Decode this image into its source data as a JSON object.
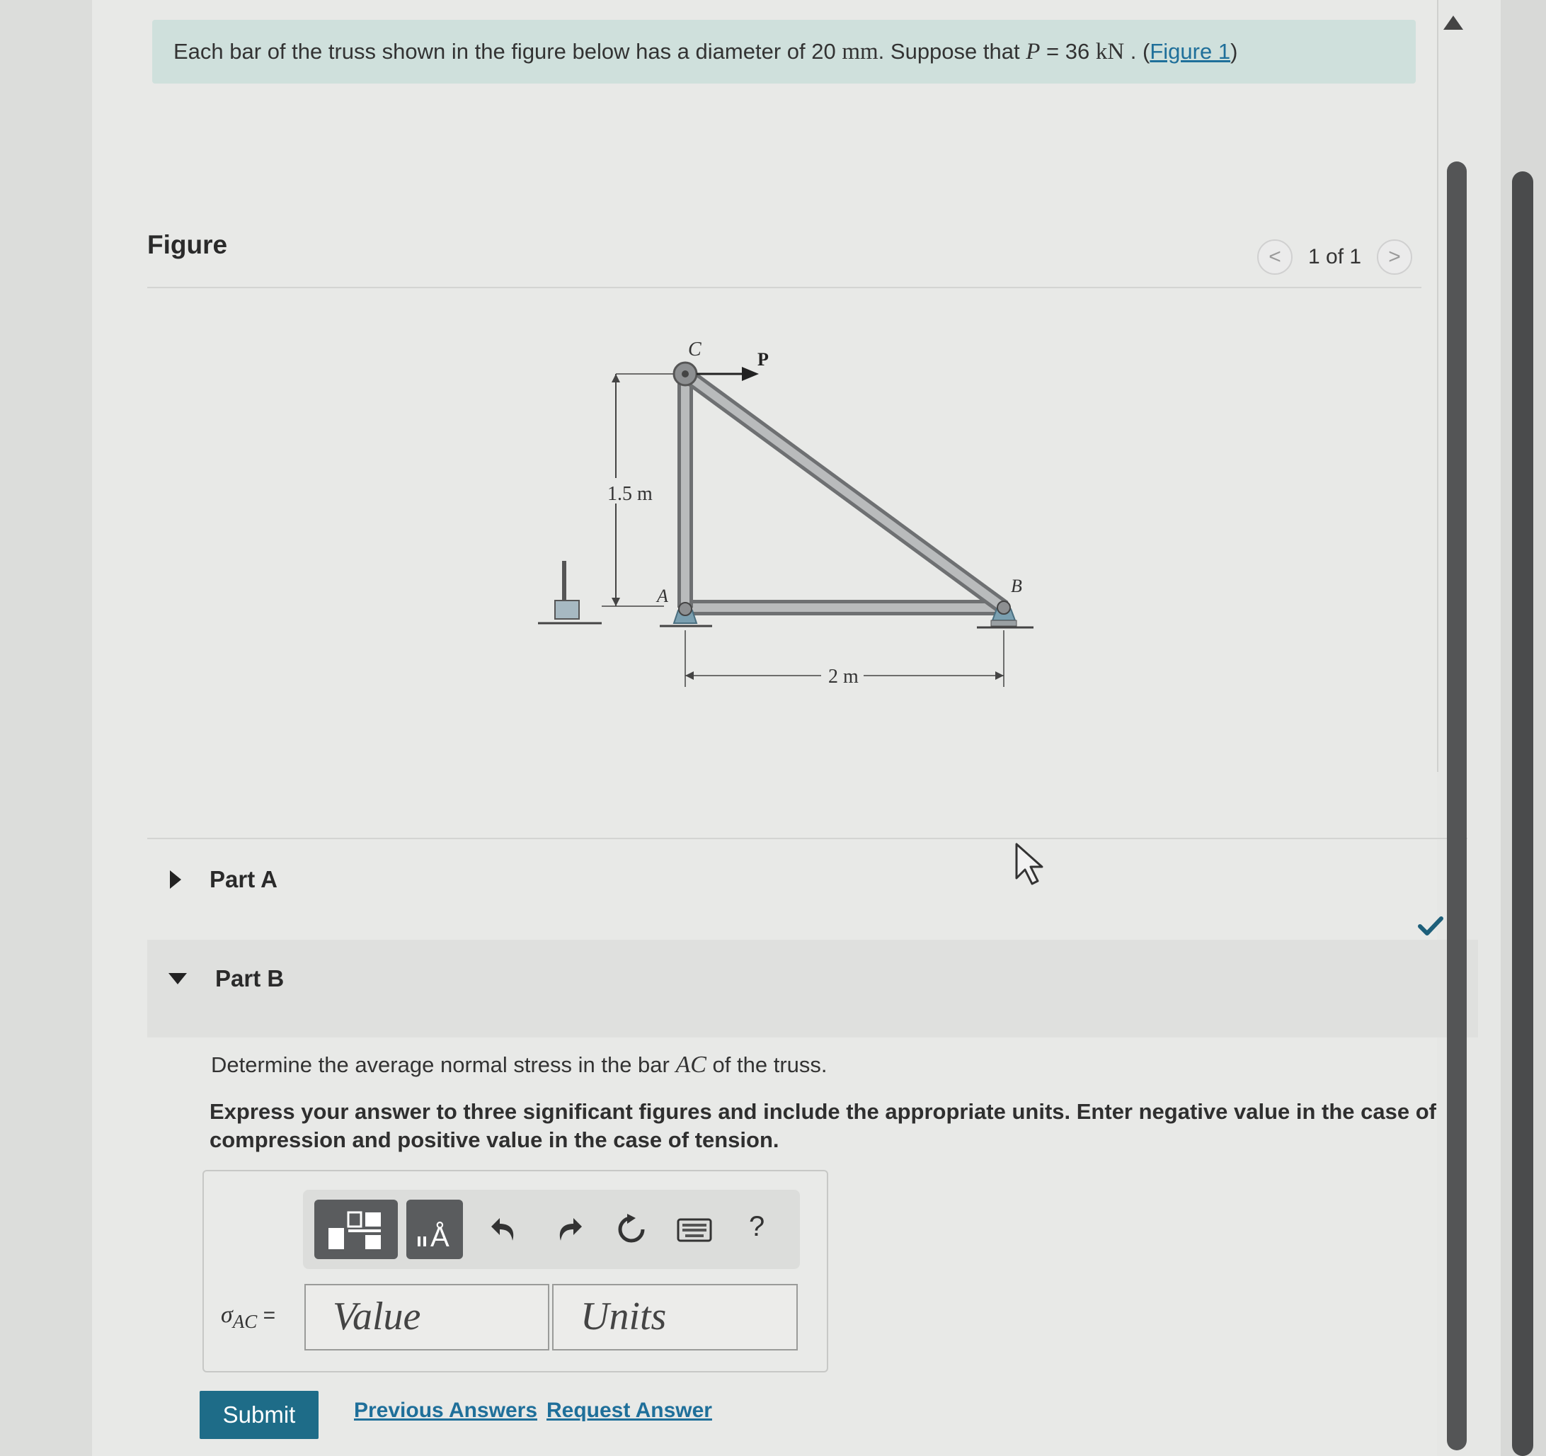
{
  "intro": {
    "text_before": "Each bar of the truss shown in the figure below has a diameter of 20 ",
    "diameter_unit": "mm",
    "text_middle": ". Suppose that ",
    "p_symbol": "P",
    "p_value": " = 36 ",
    "p_unit": "kN",
    "text_after": " . (",
    "figure_link": "Figure 1",
    "close": ")"
  },
  "figure": {
    "heading": "Figure",
    "pager": {
      "label": "1 of 1",
      "prev": "<",
      "next": ">"
    },
    "labels": {
      "node_c": "C",
      "node_a": "A",
      "node_b": "B",
      "load": "P",
      "height": "1.5 m",
      "width": "2 m"
    }
  },
  "parts": [
    {
      "label": "Part A",
      "state": "collapsed"
    },
    {
      "label": "Part B",
      "state": "expanded",
      "completed": true
    }
  ],
  "part_b": {
    "question_before": "Determine the average normal stress in the bar ",
    "bar": "AC",
    "question_after": " of the truss.",
    "instruction": "Express your answer to three significant figures and include the appropriate units. Enter negative value in the case of compression and positive value in the case of tension.",
    "answer": {
      "symbol": "σ",
      "subscript": "AC",
      "equals": " =",
      "value_placeholder": "Value",
      "units_placeholder": "Units"
    },
    "toolbar": {
      "help": "?",
      "units_glyph": "Å",
      "icons": [
        "templates-icon",
        "units-icon",
        "undo-icon",
        "redo-icon",
        "reset-icon",
        "keyboard-icon",
        "help-icon"
      ]
    },
    "submit": "Submit",
    "previous_answers": "Previous Answers",
    "request_answer": "Request Answer"
  },
  "colors": {
    "intro_bg": "#cfe0dc",
    "link": "#1f6f9a",
    "submit_bg": "#1e6c88",
    "check": "#1d5f7a"
  }
}
